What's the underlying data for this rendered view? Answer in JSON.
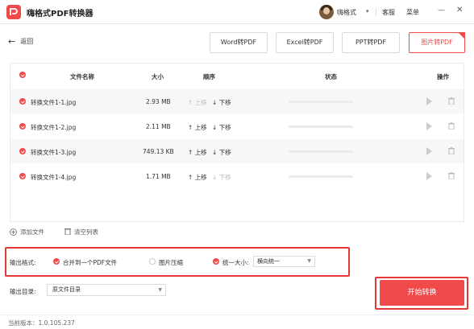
{
  "app": {
    "title": "嗨格式PDF转换器"
  },
  "header": {
    "user_name": "嗨格式",
    "user_caret": "▾",
    "service": "客服",
    "menu": "菜单",
    "minimize": "—",
    "close": "✕"
  },
  "toolbar": {
    "back_label": "返回",
    "tabs": [
      "Word转PDF",
      "Excel转PDF",
      "PPT转PDF",
      "图片转PDF"
    ],
    "active_tab": "图片转PDF"
  },
  "table": {
    "columns": [
      "文件名称",
      "大小",
      "顺序",
      "状态",
      "操作"
    ],
    "rows": [
      {
        "name": "转换文件1-1.jpg",
        "size": "2.93 MB",
        "up": "上移",
        "down": "下移",
        "up_disabled": true,
        "down_disabled": false
      },
      {
        "name": "转换文件1-2.jpg",
        "size": "2.11 MB",
        "up": "上移",
        "down": "下移",
        "up_disabled": false,
        "down_disabled": false
      },
      {
        "name": "转换文件1-3.jpg",
        "size": "749.13 KB",
        "up": "上移",
        "down": "下移",
        "up_disabled": false,
        "down_disabled": false
      },
      {
        "name": "转换文件1-4.jpg",
        "size": "1.71 MB",
        "up": "上移",
        "down": "下移",
        "up_disabled": false,
        "down_disabled": true
      }
    ]
  },
  "actions": {
    "add_file": "添加文件",
    "clear_list": "清空列表"
  },
  "output_format": {
    "label": "输出格式:",
    "merge_label": "合并到一个PDF文件",
    "merge_checked": true,
    "compress_label": "图片压缩",
    "compress_checked": false,
    "uniform_label": "统一大小:",
    "uniform_checked": true,
    "size_value": "横向统一"
  },
  "output_dir": {
    "label": "输出目录:",
    "value": "原文件目录"
  },
  "start_button": "开始转换",
  "version": "当前版本：1.0.105.237",
  "colors": {
    "accent": "#f04a4a",
    "highlight_box": "#e53935"
  }
}
